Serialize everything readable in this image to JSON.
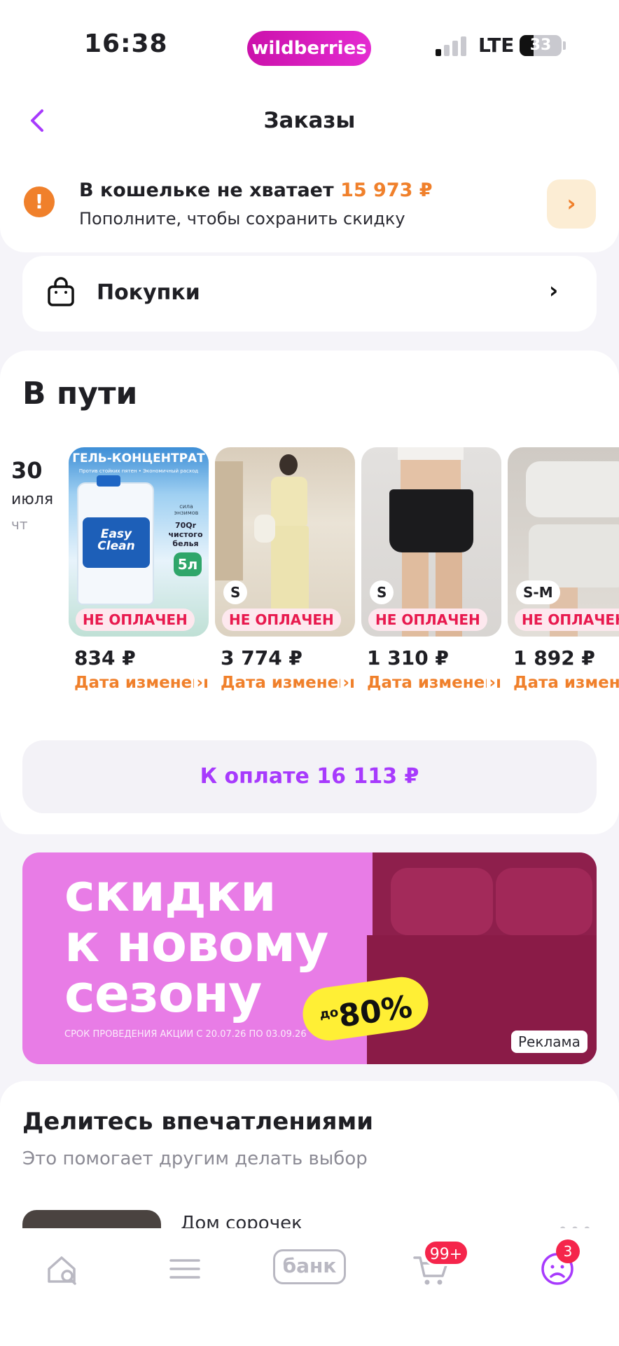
{
  "status_bar": {
    "time": "16:38",
    "brand": "wildberries",
    "network": "LTE",
    "battery": "33",
    "battery_level": 0.33
  },
  "header": {
    "title": "Заказы",
    "back_icon": "chevron-left-icon"
  },
  "wallet": {
    "title": "В кошельке не хватает",
    "amount": "15 973 ₽",
    "subtitle": "Пополните, чтобы сохранить скидку",
    "icon": "warning-icon",
    "accent": "#f0802b"
  },
  "purchases": {
    "label": "Покупки",
    "icon": "bag-icon"
  },
  "transit": {
    "title": "В пути",
    "date": {
      "day": "30",
      "month": "июля",
      "weekday": "чт"
    },
    "products": [
      {
        "size": "",
        "badge": "НЕ ОПЛАЧЕН",
        "price": "834 ₽",
        "change": "Дата изменения",
        "image_header": "ГЕЛЬ-КОНЦЕНТРАТ",
        "image_sub": "Против стойких пятен • Экономичный расход",
        "image_brand": "Easy Clean",
        "image_volume": "5л",
        "image_info": "сила энзимов",
        "image_info2": "70Qr чистого белья"
      },
      {
        "size": "S",
        "badge": "НЕ ОПЛАЧЕН",
        "price": "3 774 ₽",
        "change": "Дата изменения"
      },
      {
        "size": "S",
        "badge": "НЕ ОПЛАЧЕН",
        "price": "1 310 ₽",
        "change": "Дата изменения"
      },
      {
        "size": "S-M",
        "badge": "НЕ ОПЛАЧЕН",
        "price": "1 892 ₽",
        "change": "Дата изменения"
      }
    ],
    "pay_button": "К оплате 16 113 ₽",
    "pay_color": "#a73afd"
  },
  "banner": {
    "line1": "скидки",
    "line2": "к новому",
    "line3": "сезону",
    "sale_prefix": "до",
    "sale_value": "80%",
    "fine_print": "СРОК ПРОВЕДЕНИЯ АКЦИИ С 20.07.26 ПО 03.09.26",
    "ad_label": "Реклама"
  },
  "share": {
    "title": "Делитесь впечатлениями",
    "subtitle": "Это помогает другим делать выбор",
    "item_name": "Дом сорочек"
  },
  "tabbar": {
    "bank_label": "банк",
    "cart_badge": "99+",
    "profile_badge": "3"
  }
}
